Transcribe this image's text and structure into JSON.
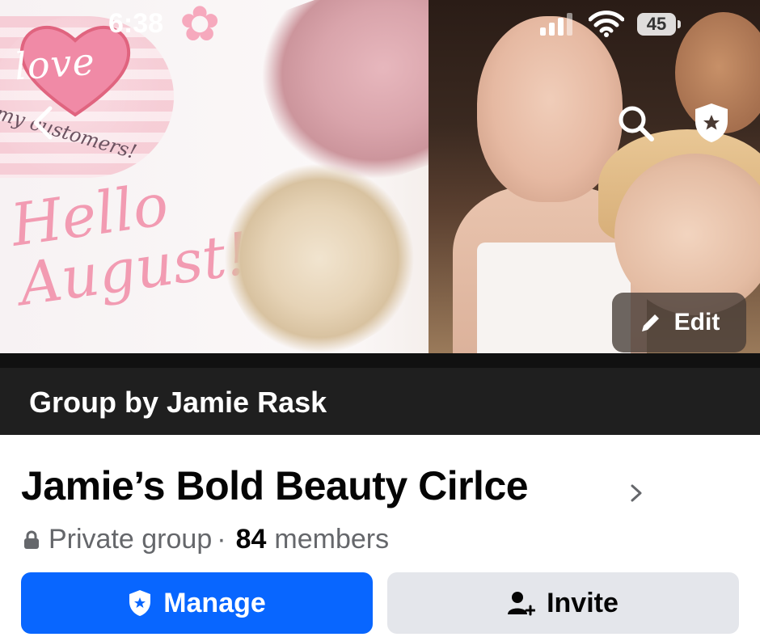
{
  "status_bar": {
    "time": "6:38",
    "battery": "45",
    "icons": [
      "cellular-signal-icon",
      "wifi-icon",
      "battery-icon"
    ]
  },
  "cover": {
    "love_text": "love",
    "customers_text": "my customers!",
    "hello_line1": "Hello",
    "hello_line2": "August!",
    "edit_label": "Edit"
  },
  "header_icons": [
    "back-chevron-icon",
    "search-icon",
    "admin-shield-icon"
  ],
  "group": {
    "owner_label": "Group by Jamie Rask",
    "name": "Jamie’s Bold Beauty Cirlce",
    "privacy": "Private group",
    "separator": "·",
    "member_count": "84",
    "members_label": "members"
  },
  "actions": {
    "manage_label": "Manage",
    "invite_label": "Invite"
  },
  "colors": {
    "primary_blue": "#0866ff",
    "secondary_gray": "#e4e6eb",
    "dark_bar": "#1f1f1f",
    "text_primary": "#050505",
    "text_secondary": "#65676b"
  }
}
